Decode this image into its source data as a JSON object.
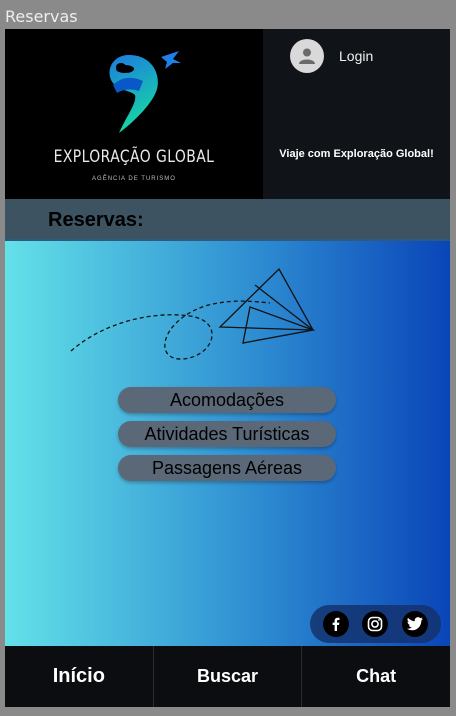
{
  "window": {
    "title": "Reservas"
  },
  "header": {
    "brand_name": "EXPLORAÇÃO GLOBAL",
    "brand_subtitle": "AGÊNCIA DE TURISMO",
    "login_label": "Login",
    "tagline": "Viaje com Exploração Global!"
  },
  "section": {
    "title": "Reservas:"
  },
  "menu": {
    "items": [
      {
        "label": "Acomodações"
      },
      {
        "label": "Atividades Turísticas"
      },
      {
        "label": "Passagens Aéreas"
      }
    ]
  },
  "social": {
    "icons": [
      "facebook-icon",
      "instagram-icon",
      "twitter-icon"
    ]
  },
  "nav": {
    "items": [
      {
        "label": "Início"
      },
      {
        "label": "Buscar"
      },
      {
        "label": "Chat"
      }
    ]
  },
  "colors": {
    "gradient_start": "#63e1e8",
    "gradient_end": "#0a45b8",
    "button_bg": "#5a6878",
    "section_bar": "#3e5362"
  }
}
